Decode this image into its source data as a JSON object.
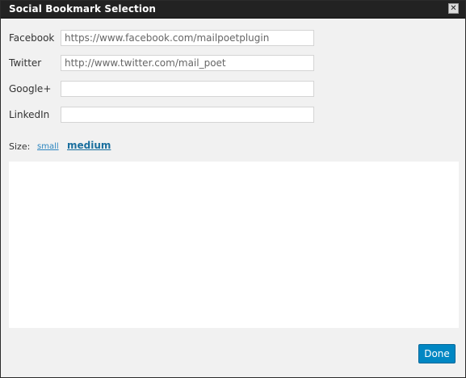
{
  "dialog": {
    "title": "Social Bookmark Selection",
    "close_icon": "close-icon",
    "close_glyph": "✕"
  },
  "fields": [
    {
      "label": "Facebook",
      "value": "https://www.facebook.com/mailpoetplugin",
      "placeholder": ""
    },
    {
      "label": "Twitter",
      "value": "http://www.twitter.com/mail_poet",
      "placeholder": ""
    },
    {
      "label": "Google+",
      "value": "",
      "placeholder": ""
    },
    {
      "label": "LinkedIn",
      "value": "",
      "placeholder": ""
    }
  ],
  "size": {
    "label": "Size:",
    "options": [
      {
        "label": "small",
        "selected": false
      },
      {
        "label": "medium",
        "selected": true
      }
    ]
  },
  "footer": {
    "done_label": "Done"
  },
  "colors": {
    "titlebar_bg": "#222222",
    "dialog_bg": "#f1f1f1",
    "accent": "#0087c3",
    "link": "#2b85bf"
  }
}
